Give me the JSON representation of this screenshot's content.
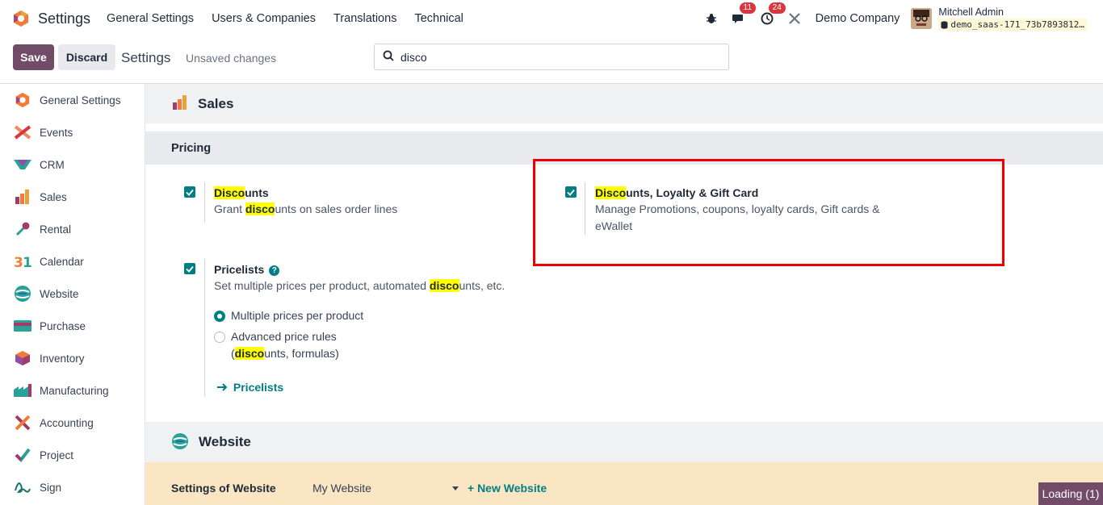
{
  "navbar": {
    "app_name": "Settings",
    "menu": [
      "General Settings",
      "Users & Companies",
      "Translations",
      "Technical"
    ],
    "messages_count": "11",
    "activities_count": "24",
    "company": "Demo Company",
    "user_name": "Mitchell Admin",
    "database": "demo_saas-171_73b7893812…"
  },
  "control": {
    "save_label": "Save",
    "discard_label": "Discard",
    "title": "Settings",
    "unsaved": "Unsaved changes",
    "search_value": "disco"
  },
  "sidebar": {
    "items": [
      {
        "label": "General Settings",
        "icon": "general-settings-icon"
      },
      {
        "label": "Events",
        "icon": "events-icon"
      },
      {
        "label": "CRM",
        "icon": "crm-icon"
      },
      {
        "label": "Sales",
        "icon": "sales-icon"
      },
      {
        "label": "Rental",
        "icon": "rental-icon"
      },
      {
        "label": "Calendar",
        "icon": "calendar-icon"
      },
      {
        "label": "Website",
        "icon": "website-icon"
      },
      {
        "label": "Purchase",
        "icon": "purchase-icon"
      },
      {
        "label": "Inventory",
        "icon": "inventory-icon"
      },
      {
        "label": "Manufacturing",
        "icon": "manufacturing-icon"
      },
      {
        "label": "Accounting",
        "icon": "accounting-icon"
      },
      {
        "label": "Project",
        "icon": "project-icon"
      },
      {
        "label": "Sign",
        "icon": "sign-icon"
      }
    ]
  },
  "main": {
    "app_title": "Sales",
    "section": "Pricing",
    "discounts": {
      "title_hl": "Disco",
      "title_rest": "unts",
      "desc_pre": "Grant ",
      "desc_hl": "disco",
      "desc_post": "unts on sales order lines",
      "checked": true
    },
    "loyalty": {
      "title_hl": "Disco",
      "title_rest": "unts, Loyalty & Gift Card",
      "desc": "Manage Promotions, coupons, loyalty cards, Gift cards & eWallet",
      "checked": true
    },
    "pricelists": {
      "title": "Pricelists",
      "help": "?",
      "desc_pre": "Set multiple prices per product, automated ",
      "desc_hl": "disco",
      "desc_post": "unts, etc.",
      "checked": true,
      "option1": "Multiple prices per product",
      "option2_line1": "Advanced price rules",
      "option2_open": "(",
      "option2_hl": "disco",
      "option2_post": "unts, formulas)",
      "selected_option": 1,
      "link": "Pricelists"
    },
    "website_title": "Website",
    "website_settings_label": "Settings of Website",
    "website_selected": "My Website",
    "new_website": "+ New Website"
  },
  "status": {
    "loading": "Loading (1)"
  },
  "colors": {
    "brand": "#714b67",
    "accent": "#017e84",
    "highlight": "#ffff00",
    "annotation": "#ee0000"
  }
}
